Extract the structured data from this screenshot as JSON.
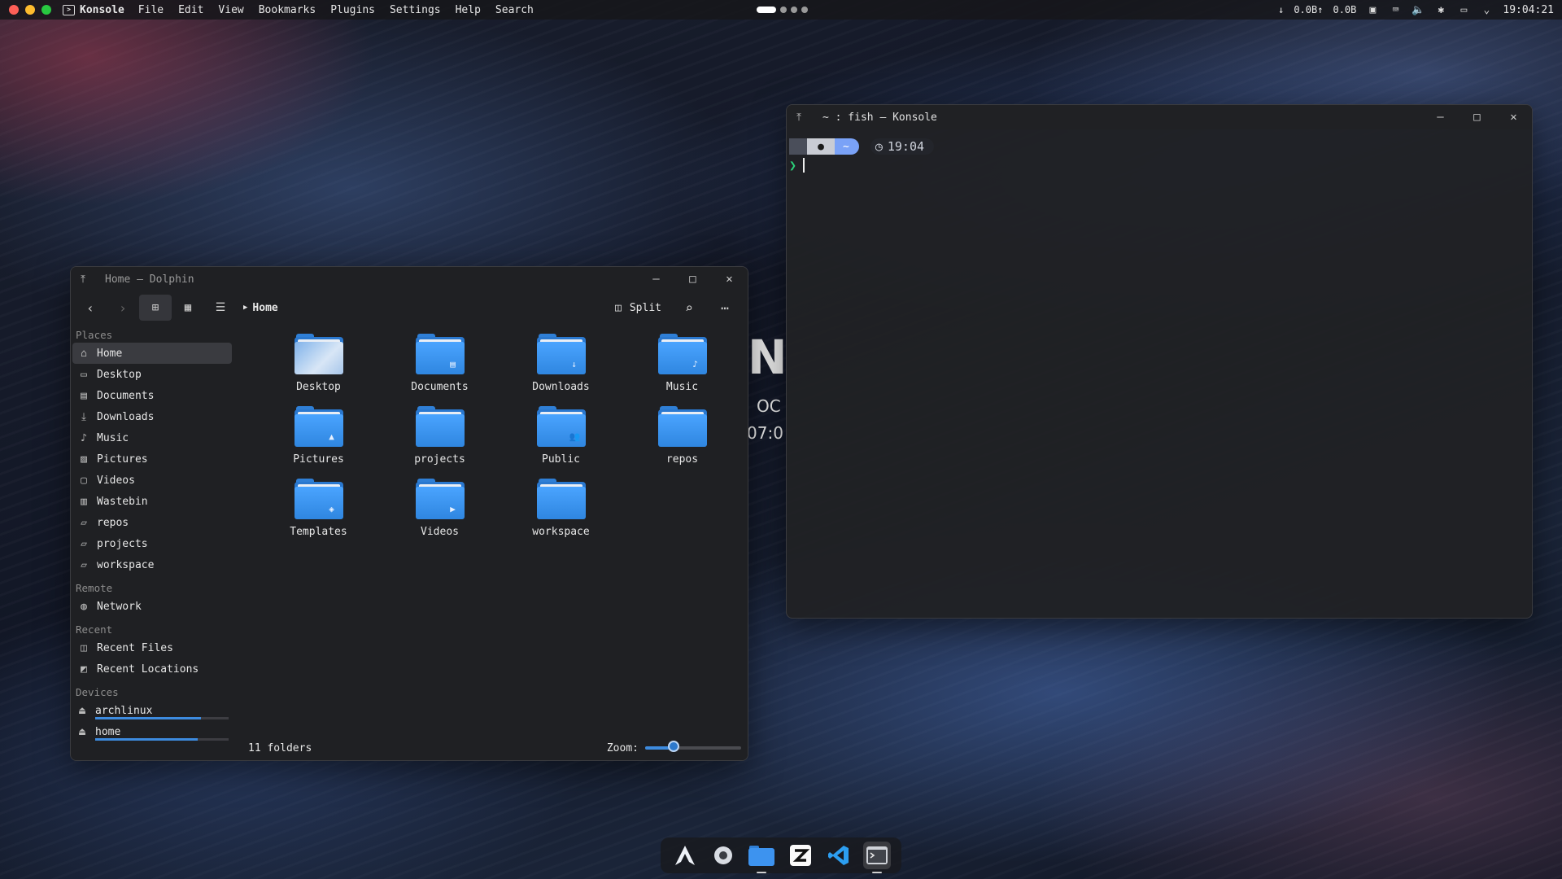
{
  "topbar": {
    "app_name": "Konsole",
    "menus": [
      "File",
      "Edit",
      "View",
      "Bookmarks",
      "Plugins",
      "Settings",
      "Help",
      "Search"
    ],
    "net_down": "0.0B",
    "net_up": "0.0B",
    "clock": "19:04:21"
  },
  "dolphin": {
    "title": "Home — Dolphin",
    "breadcrumb": "Home",
    "split_label": "Split",
    "places_header": "Places",
    "places": [
      {
        "label": "Home",
        "icon": "home-icon"
      },
      {
        "label": "Desktop",
        "icon": "desktop-icon"
      },
      {
        "label": "Documents",
        "icon": "documents-icon"
      },
      {
        "label": "Downloads",
        "icon": "downloads-icon"
      },
      {
        "label": "Music",
        "icon": "music-icon"
      },
      {
        "label": "Pictures",
        "icon": "pictures-icon"
      },
      {
        "label": "Videos",
        "icon": "videos-icon"
      },
      {
        "label": "Wastebin",
        "icon": "trash-icon"
      },
      {
        "label": "repos",
        "icon": "folder-icon"
      },
      {
        "label": "projects",
        "icon": "folder-icon"
      },
      {
        "label": "workspace",
        "icon": "folder-icon"
      }
    ],
    "remote_header": "Remote",
    "remote": [
      {
        "label": "Network",
        "icon": "network-icon"
      }
    ],
    "recent_header": "Recent",
    "recent": [
      {
        "label": "Recent Files",
        "icon": "recent-files-icon"
      },
      {
        "label": "Recent Locations",
        "icon": "recent-locations-icon"
      }
    ],
    "devices_header": "Devices",
    "devices": [
      {
        "label": "archlinux",
        "usage": 0.79
      },
      {
        "label": "home",
        "usage": 0.77
      }
    ],
    "folders": [
      {
        "label": "Desktop",
        "emblem": ""
      },
      {
        "label": "Documents",
        "emblem": "▤"
      },
      {
        "label": "Downloads",
        "emblem": "↓"
      },
      {
        "label": "Music",
        "emblem": "♪"
      },
      {
        "label": "Pictures",
        "emblem": "▲"
      },
      {
        "label": "projects",
        "emblem": ""
      },
      {
        "label": "Public",
        "emblem": "👥"
      },
      {
        "label": "repos",
        "emblem": ""
      },
      {
        "label": "Templates",
        "emblem": "◈"
      },
      {
        "label": "Videos",
        "emblem": "▶"
      },
      {
        "label": "workspace",
        "emblem": ""
      }
    ],
    "status": "11 folders",
    "zoom_label": "Zoom:",
    "zoom_level": 0.3
  },
  "konsole": {
    "title": "~ : fish — Konsole",
    "prompt_dir": "~",
    "prompt_time": "19:04",
    "prompt_char": "❯"
  },
  "wallpaper_text": {
    "line1": "N",
    "line2": "OC",
    "line3": "07:0"
  },
  "colors": {
    "accent": "#3d8bdf",
    "prompt_dir": "#7aa2f7",
    "prompt_char": "#2bd27a"
  },
  "dock": [
    {
      "name": "arch-launcher-icon"
    },
    {
      "name": "settings-icon"
    },
    {
      "name": "files-icon"
    },
    {
      "name": "zed-icon"
    },
    {
      "name": "vscode-icon"
    },
    {
      "name": "terminal-icon"
    }
  ]
}
